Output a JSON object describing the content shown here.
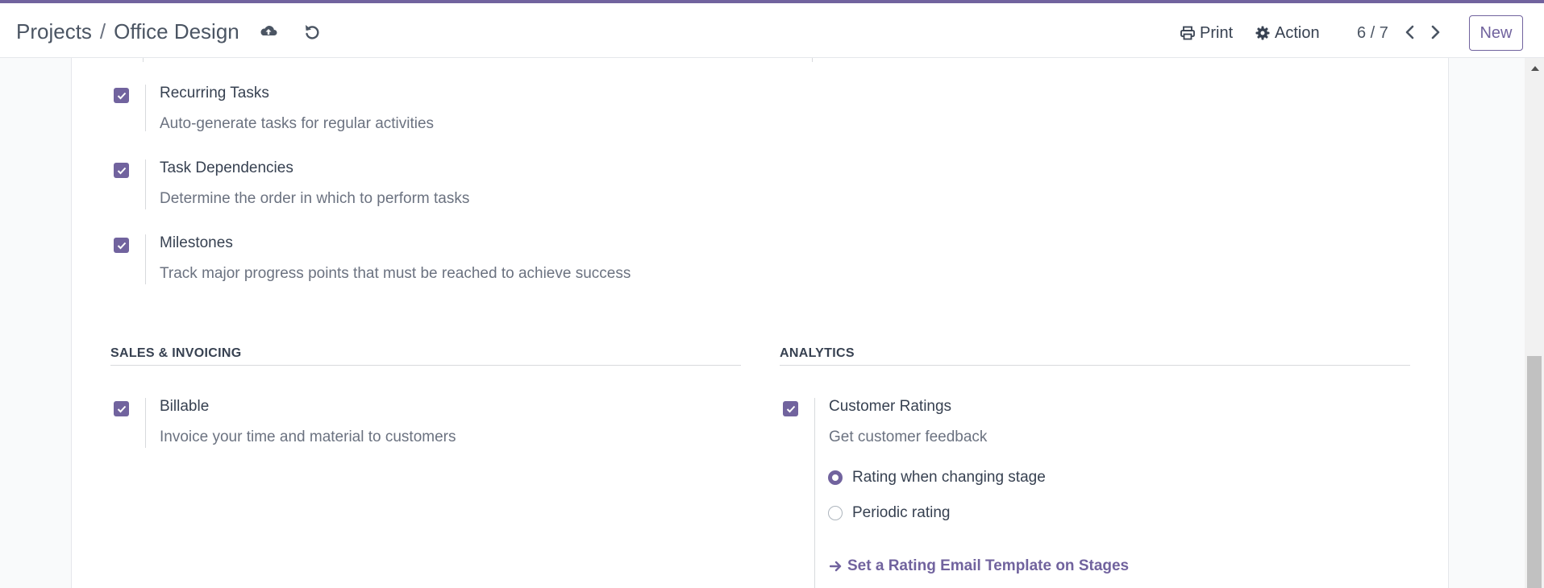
{
  "breadcrumb": {
    "parent": "Projects",
    "separator": "/",
    "current": "Office Design"
  },
  "toolbar": {
    "save_icon": "cloud-upload-icon",
    "discard_icon": "undo-icon",
    "print_label": "Print",
    "action_label": "Action",
    "pager": "6 / 7",
    "new_label": "New"
  },
  "colors": {
    "accent": "#71639e",
    "text": "#374151",
    "muted": "#6b7280"
  },
  "tasks_settings": [
    {
      "title": "Recurring Tasks",
      "description": "Auto-generate tasks for regular activities",
      "checked": true
    },
    {
      "title": "Task Dependencies",
      "description": "Determine the order in which to perform tasks",
      "checked": true
    },
    {
      "title": "Milestones",
      "description": "Track major progress points that must be reached to achieve success",
      "checked": true
    }
  ],
  "sales_section": {
    "header": "SALES & INVOICING",
    "setting": {
      "title": "Billable",
      "description": "Invoice your time and material to customers",
      "checked": true
    }
  },
  "analytics_section": {
    "header": "ANALYTICS",
    "setting": {
      "title": "Customer Ratings",
      "description": "Get customer feedback",
      "checked": true
    },
    "rating_options": [
      {
        "label": "Rating when changing stage",
        "checked": true
      },
      {
        "label": "Periodic rating",
        "checked": false
      }
    ],
    "link_label": "Set a Rating Email Template on Stages"
  }
}
